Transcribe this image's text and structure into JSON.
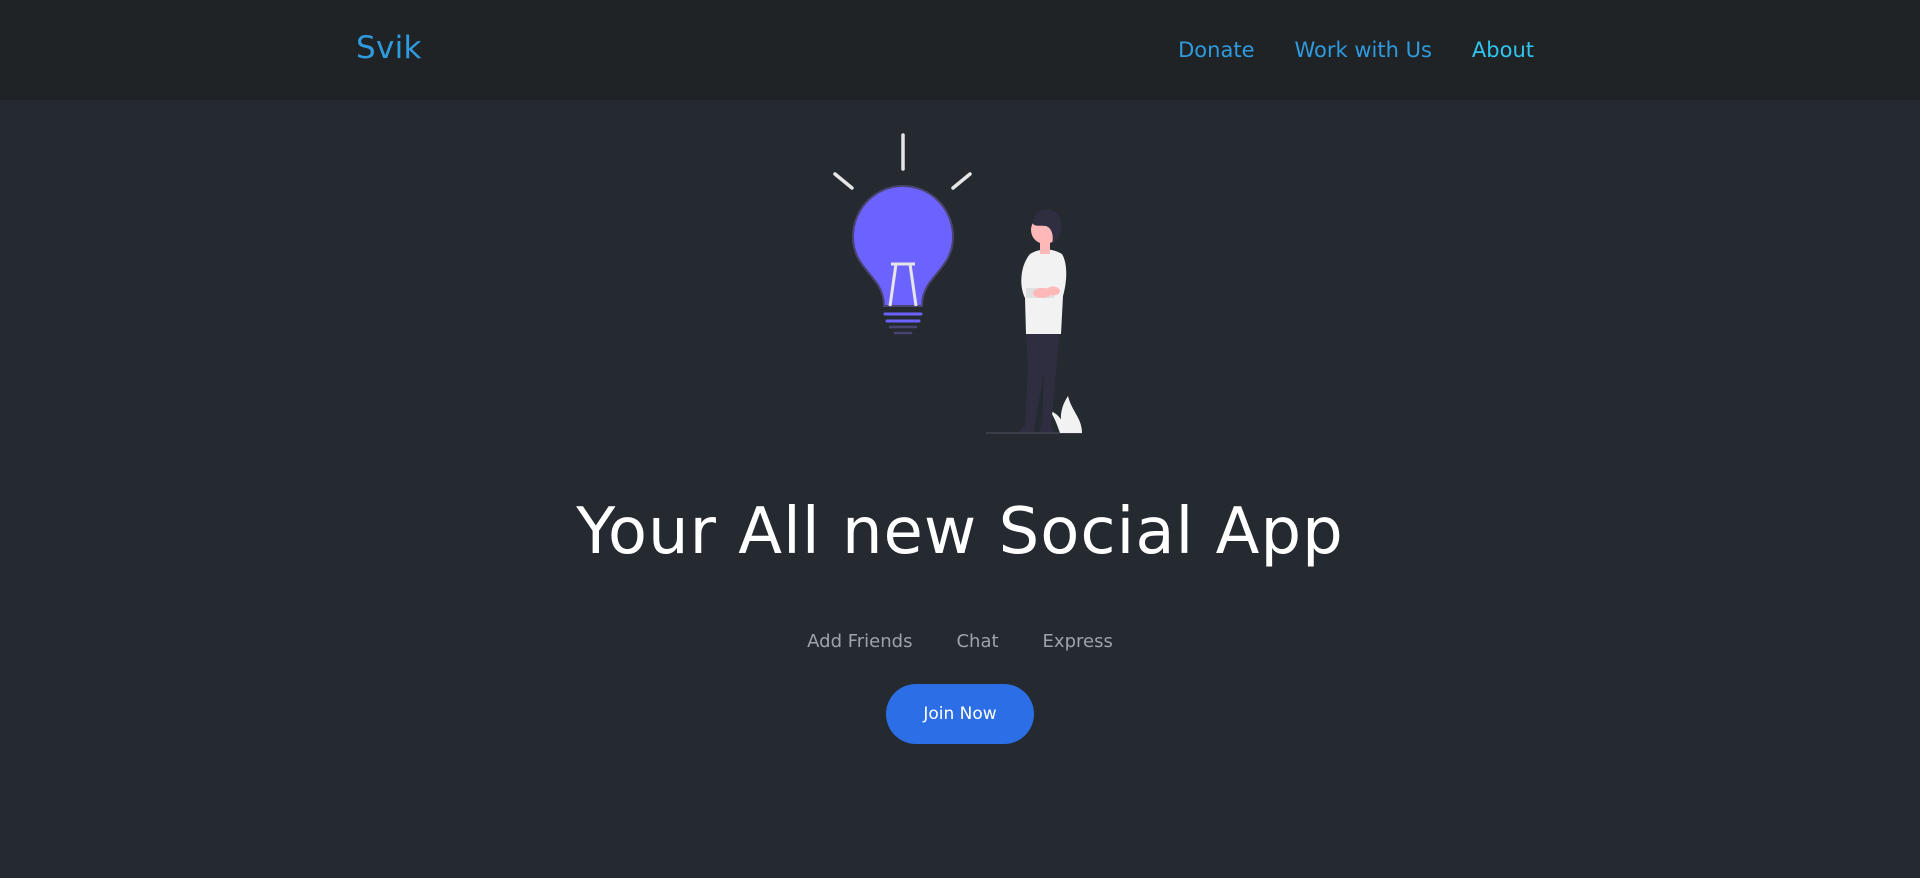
{
  "navbar": {
    "brand": "Svik",
    "links": [
      {
        "label": "Donate"
      },
      {
        "label": "Work with Us"
      },
      {
        "label": "About"
      }
    ]
  },
  "hero": {
    "illustration": {
      "icons": [
        "lightbulb-icon",
        "person-illustration"
      ],
      "bulb_color": "#6c63ff"
    },
    "headline": "Your All new Social App",
    "features": [
      "Add Friends",
      "Chat",
      "Express"
    ],
    "cta_label": "Join Now"
  },
  "colors": {
    "background": "#252a31",
    "navbar": "#202326",
    "link": "#2e9bdf",
    "link_active": "#2ec6ef",
    "button": "#2c6ee5"
  }
}
